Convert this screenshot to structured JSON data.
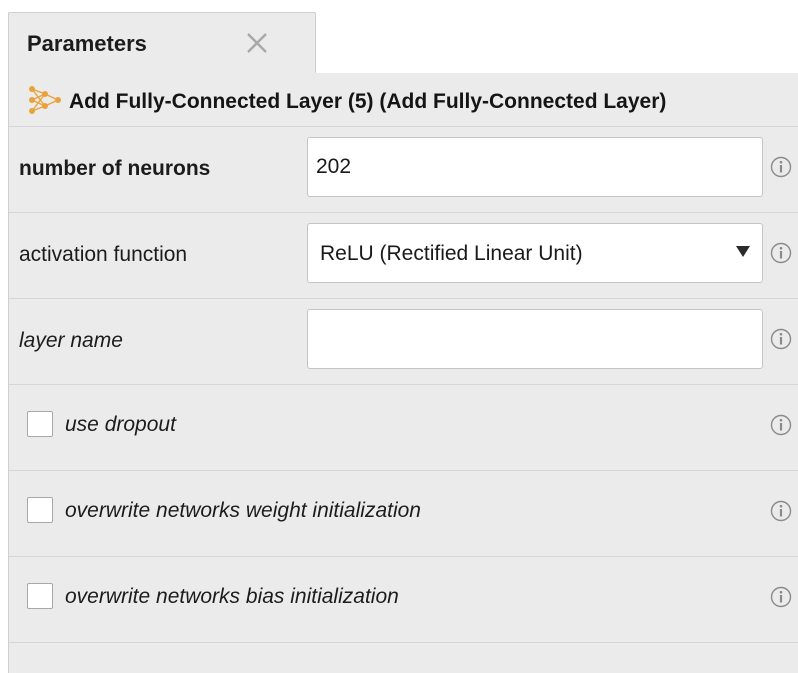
{
  "tab": {
    "label": "Parameters",
    "close_icon": "close-icon"
  },
  "operator": {
    "icon": "neural-layer-icon",
    "title": "Add Fully-Connected Layer (5) (Add Fully-Connected Layer)"
  },
  "parameters": {
    "neurons": {
      "label": "number of neurons",
      "value": "202"
    },
    "activation": {
      "label": "activation function",
      "selected": "ReLU (Rectified Linear Unit)"
    },
    "layer_name": {
      "label": "layer name",
      "value": "",
      "placeholder": ""
    },
    "use_dropout": {
      "label": "use dropout",
      "checked": false
    },
    "overwrite_weight": {
      "label": "overwrite networks weight initialization",
      "checked": false
    },
    "overwrite_bias": {
      "label": "overwrite networks bias initialization",
      "checked": false
    }
  },
  "colors": {
    "panel_bg": "#ebebeb",
    "border": "#cfcfcf",
    "icon_orange": "#e8a33c",
    "info_gray": "#8a8a8a"
  }
}
